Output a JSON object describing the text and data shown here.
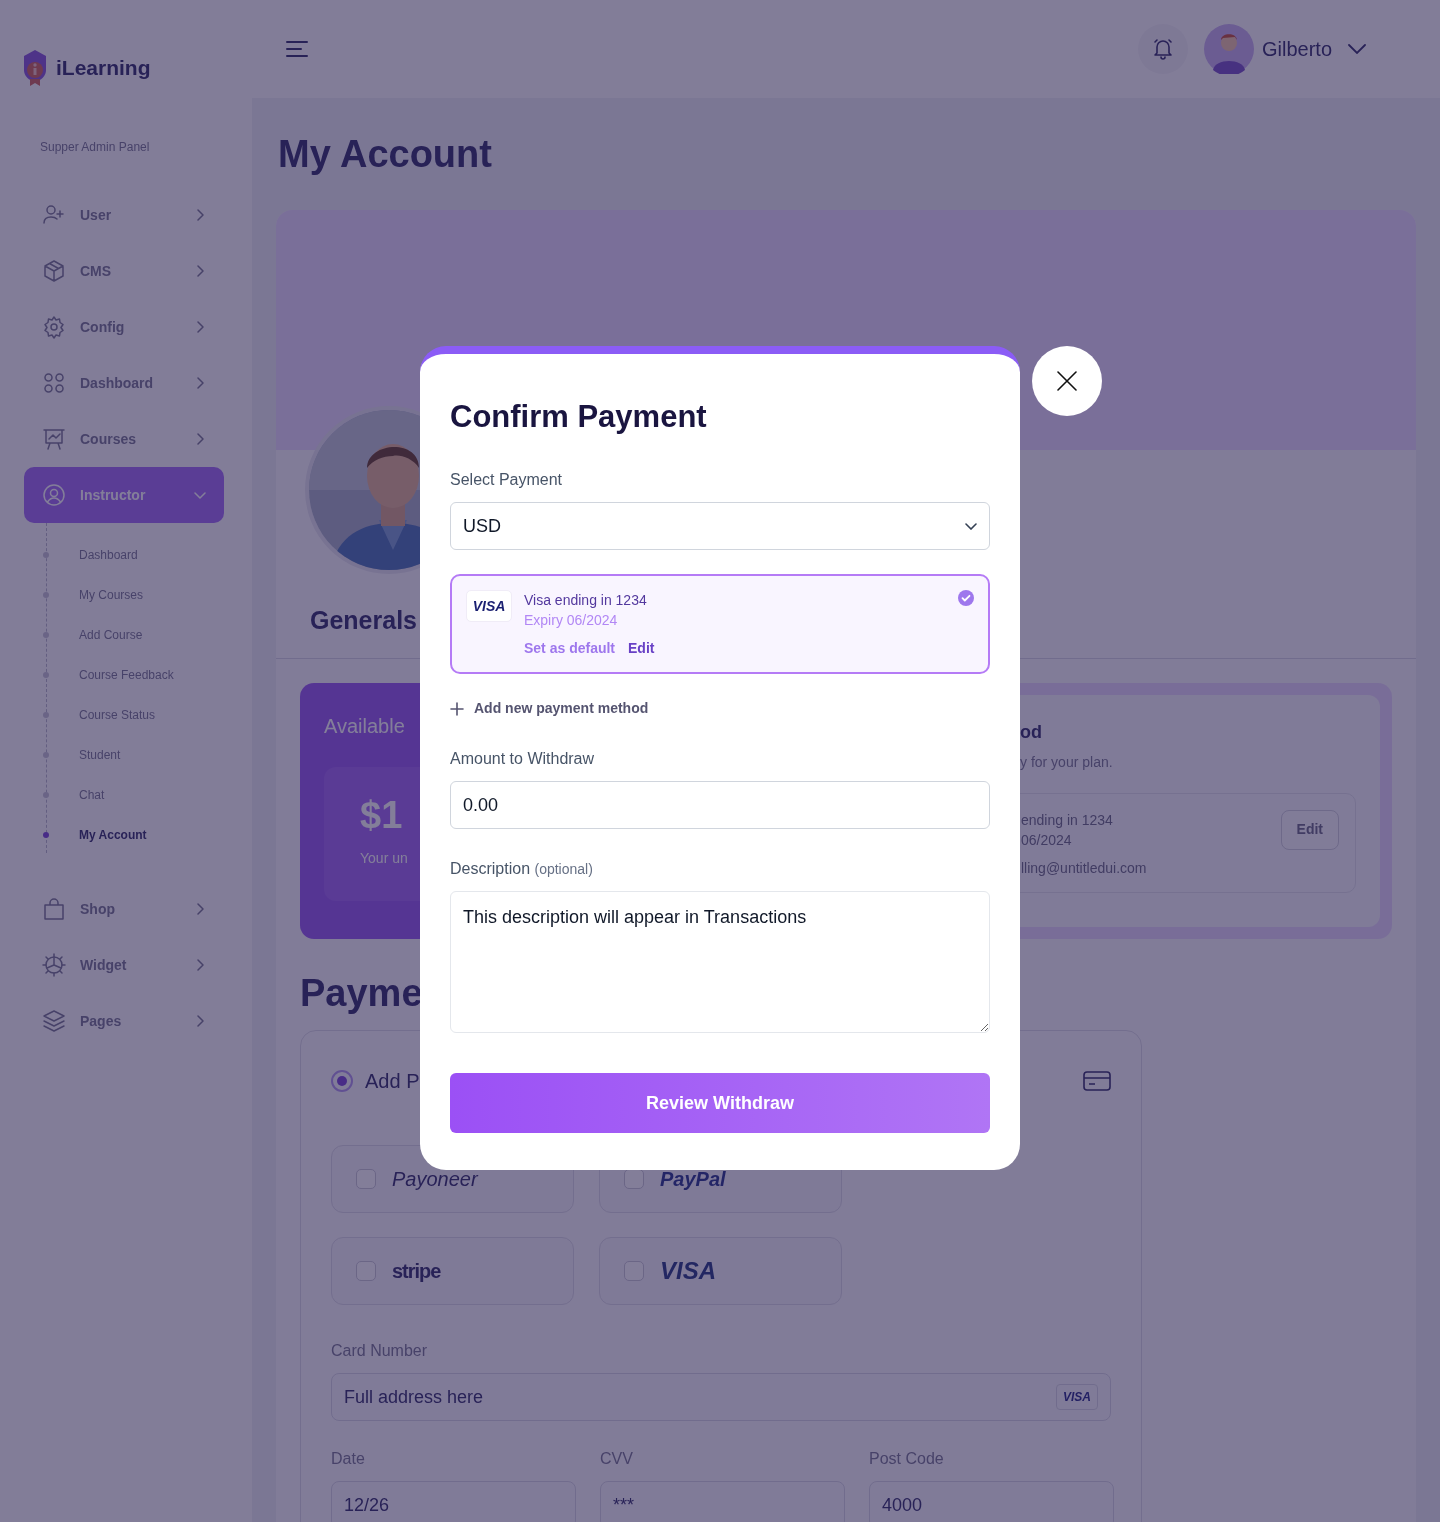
{
  "brand": {
    "name": "iLearning"
  },
  "header": {
    "user_name": "Gilberto"
  },
  "sidebar": {
    "panel_title": "Supper Admin Panel",
    "items": [
      {
        "label": "User",
        "selected": false,
        "expanded": false
      },
      {
        "label": "CMS",
        "selected": false,
        "expanded": false
      },
      {
        "label": "Config",
        "selected": false,
        "expanded": false
      },
      {
        "label": "Dashboard",
        "selected": false,
        "expanded": false
      },
      {
        "label": "Courses",
        "selected": false,
        "expanded": false
      },
      {
        "label": "Instructor",
        "selected": true,
        "expanded": true,
        "children": [
          {
            "label": "Dashboard",
            "selected": false
          },
          {
            "label": "My Courses",
            "selected": false
          },
          {
            "label": "Add Course",
            "selected": false
          },
          {
            "label": "Course Feedback",
            "selected": false
          },
          {
            "label": "Course Status",
            "selected": false
          },
          {
            "label": "Student",
            "selected": false
          },
          {
            "label": "Chat",
            "selected": false
          },
          {
            "label": "My Account",
            "selected": true
          }
        ]
      },
      {
        "label": "Shop",
        "selected": false,
        "expanded": false
      },
      {
        "label": "Widget",
        "selected": false,
        "expanded": false
      },
      {
        "label": "Pages",
        "selected": false,
        "expanded": false
      }
    ]
  },
  "page": {
    "title": "My Account",
    "profile_tab": "Generals",
    "balance_card": {
      "title": "Available",
      "amount": "$1",
      "caption": "Your un"
    },
    "payment_card": {
      "title": "od",
      "subtitle": "y for your plan.",
      "card_line": "ending in 1234",
      "expiry": "06/2024",
      "email": "lling@untitledui.com",
      "edit_button": "Edit"
    },
    "payment_section": {
      "title": "Payme",
      "option_label": "Add P",
      "option_selected": true,
      "methods": [
        {
          "label": "Payoneer",
          "checked": false
        },
        {
          "label": "PayPal",
          "checked": false
        },
        {
          "label": "stripe",
          "checked": false
        },
        {
          "label": "VISA",
          "checked": false
        }
      ],
      "card_number": {
        "label": "Card Number",
        "value": "Full address here",
        "badge": "VISA"
      },
      "fields": [
        {
          "label": "Date",
          "value": "12/26"
        },
        {
          "label": "CVV",
          "value": "***"
        },
        {
          "label": "Post Code",
          "value": "4000"
        }
      ]
    }
  },
  "modal": {
    "title": "Confirm Payment",
    "select": {
      "label": "Select Payment",
      "value": "USD"
    },
    "saved_card": {
      "brand": "VISA",
      "name": "Visa ending in 1234",
      "expiry": "Expiry 06/2024",
      "actions": [
        "Set as default",
        "Edit"
      ],
      "selected": true
    },
    "add_method": "Add new payment method",
    "amount": {
      "label": "Amount to Withdraw",
      "value": "0.00"
    },
    "description": {
      "label": "Description",
      "hint": "(optional)",
      "value": "This description will appear in Transactions"
    },
    "submit": "Review Withdraw"
  }
}
